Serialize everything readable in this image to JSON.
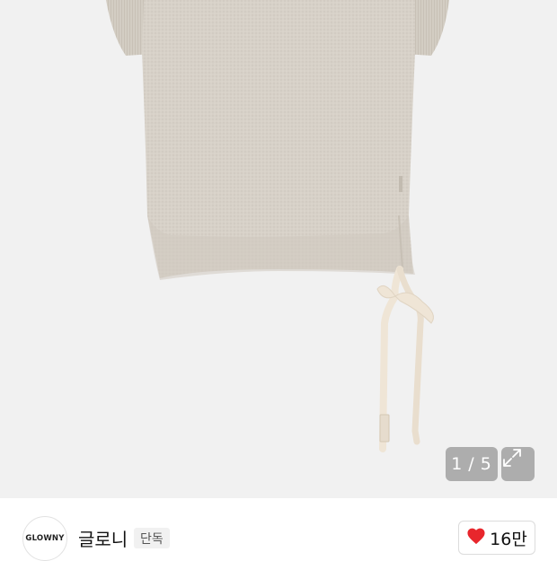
{
  "product_image": {
    "alt": "",
    "pager": {
      "current": "1",
      "separator": "/",
      "total": "5"
    }
  },
  "brand": {
    "logo_text": "GLOWNY",
    "name": "글로니",
    "badge": "단독"
  },
  "like": {
    "count": "16만",
    "color": "#e8262c"
  },
  "tag_text": "GLOWNY",
  "icons": [
    "expand-icon",
    "heart-icon"
  ]
}
